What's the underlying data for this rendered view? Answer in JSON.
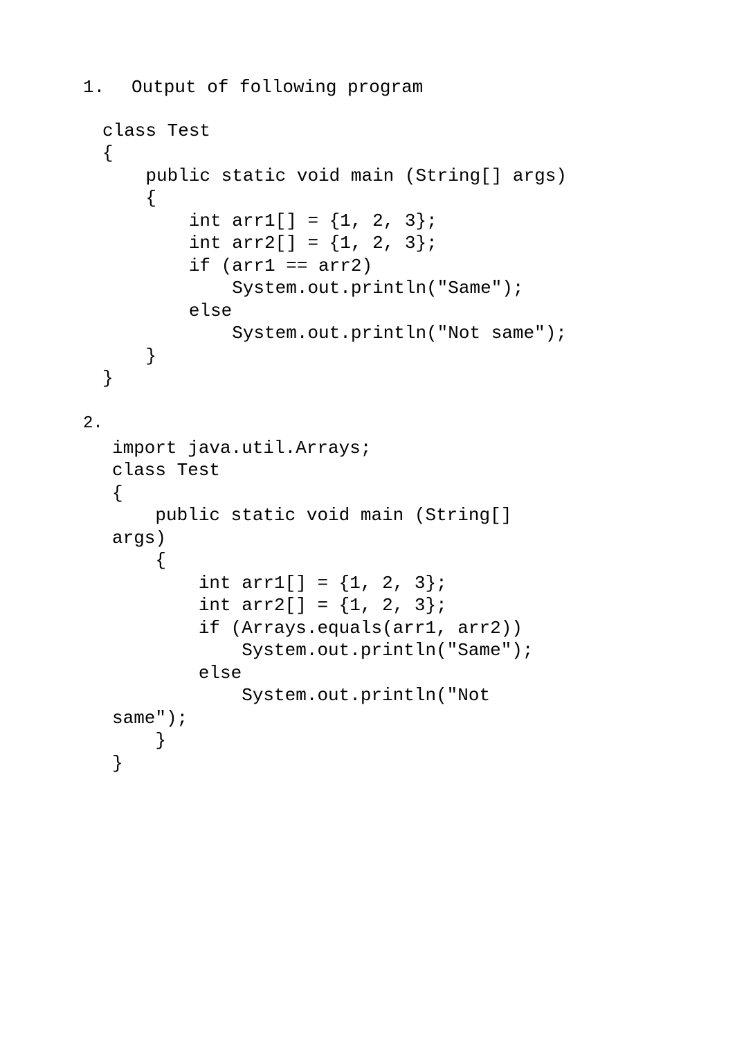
{
  "q1": {
    "number": "1.",
    "title": "Output of following program",
    "code": "class Test\n{\n    public static void main (String[] args)\n    {\n        int arr1[] = {1, 2, 3};\n        int arr2[] = {1, 2, 3};\n        if (arr1 == arr2)\n            System.out.println(\"Same\");\n        else\n            System.out.println(\"Not same\");\n    }\n}"
  },
  "q2": {
    "number": "2.",
    "code": "import java.util.Arrays;\nclass Test\n{\n    public static void main (String[] \nargs)\n    {\n        int arr1[] = {1, 2, 3};\n        int arr2[] = {1, 2, 3};\n        if (Arrays.equals(arr1, arr2))\n            System.out.println(\"Same\");\n        else\n            System.out.println(\"Not \nsame\");\n    }\n}"
  }
}
